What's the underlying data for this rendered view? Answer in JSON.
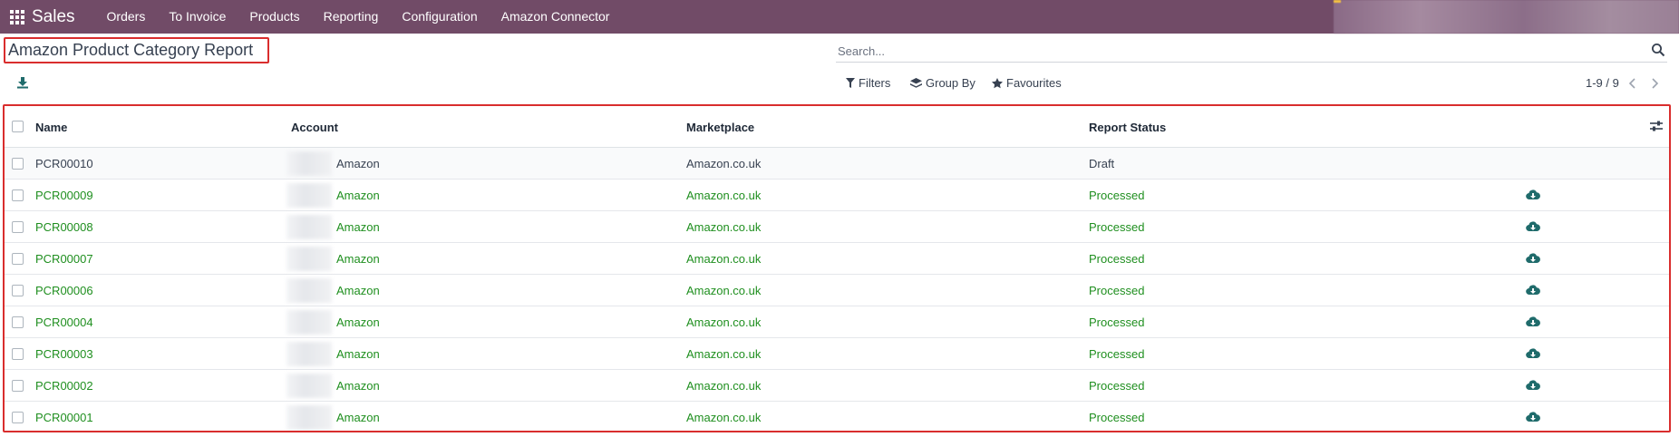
{
  "navbar": {
    "app_name": "Sales",
    "menu": [
      "Orders",
      "To Invoice",
      "Products",
      "Reporting",
      "Configuration",
      "Amazon Connector"
    ]
  },
  "control_panel": {
    "title": "Amazon Product Category Report",
    "search_placeholder": "Search...",
    "filters_label": "Filters",
    "group_by_label": "Group By",
    "favourites_label": "Favourites",
    "pager_value": "1-9 / 9"
  },
  "table": {
    "columns": [
      "Name",
      "Account",
      "Marketplace",
      "Report Status"
    ],
    "rows": [
      {
        "name": "PCR00010",
        "account": "Amazon",
        "marketplace": "Amazon.co.uk",
        "status": "Draft"
      },
      {
        "name": "PCR00009",
        "account": "Amazon",
        "marketplace": "Amazon.co.uk",
        "status": "Processed"
      },
      {
        "name": "PCR00008",
        "account": "Amazon",
        "marketplace": "Amazon.co.uk",
        "status": "Processed"
      },
      {
        "name": "PCR00007",
        "account": "Amazon",
        "marketplace": "Amazon.co.uk",
        "status": "Processed"
      },
      {
        "name": "PCR00006",
        "account": "Amazon",
        "marketplace": "Amazon.co.uk",
        "status": "Processed"
      },
      {
        "name": "PCR00004",
        "account": "Amazon",
        "marketplace": "Amazon.co.uk",
        "status": "Processed"
      },
      {
        "name": "PCR00003",
        "account": "Amazon",
        "marketplace": "Amazon.co.uk",
        "status": "Processed"
      },
      {
        "name": "PCR00002",
        "account": "Amazon",
        "marketplace": "Amazon.co.uk",
        "status": "Processed"
      },
      {
        "name": "PCR00001",
        "account": "Amazon",
        "marketplace": "Amazon.co.uk",
        "status": "Processed"
      }
    ]
  },
  "colors": {
    "navbar": "#714B67",
    "processed": "#1f8f1f",
    "highlight_border": "#d92d2d",
    "action_icon": "#1f6b6b"
  },
  "icons": {
    "apps": "apps-grid-icon",
    "download": "download-icon",
    "search": "search-icon",
    "filters": "filter-icon",
    "group_by": "layers-icon",
    "favourites": "star-icon",
    "row_action": "cloud-download-icon",
    "optional_columns": "sliders-icon"
  }
}
